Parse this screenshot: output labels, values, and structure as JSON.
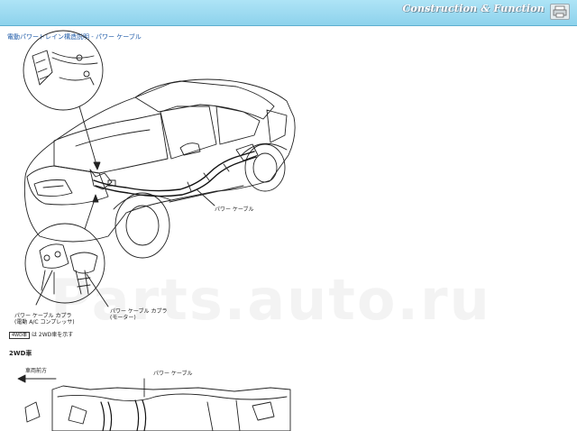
{
  "header": {
    "title": "Construction & Function",
    "print_icon": "printer-icon"
  },
  "breadcrumb": "電動パワートレイン構造説明 - パワー ケーブル",
  "labels": {
    "power_cable_top": "パワー ケーブル",
    "coupler_left_line1": "パワー ケーブル カプラ",
    "coupler_left_line2": "(電動 A/C コンプレッサ)",
    "coupler_right_line1": "パワー ケーブル カプラ",
    "coupler_right_line2": "(モーター)",
    "power_cable_bottom": "パワー ケーブル",
    "front_direction": "車両前方"
  },
  "legend": {
    "box": "4WD車",
    "text": "は 2WD車を示す"
  },
  "section": {
    "title": "2WD車"
  },
  "watermark": "Parts.auto.ru",
  "colors": {
    "header_bg": "#8dd2ec",
    "link": "#1e5aa8"
  }
}
